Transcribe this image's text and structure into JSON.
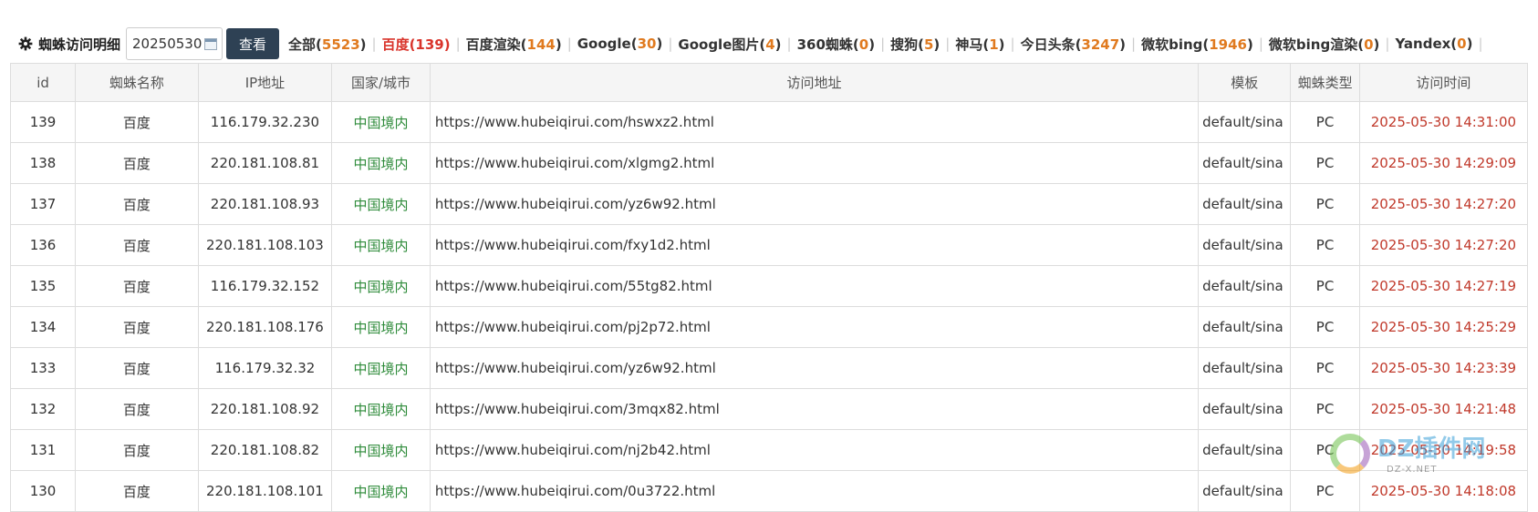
{
  "toolbar": {
    "title": "蜘蛛访问明细",
    "date_value": "20250530",
    "view_button": "查看",
    "filters": [
      {
        "label": "全部(",
        "count": "5523",
        "suffix": ")",
        "active": false
      },
      {
        "label": "百度(",
        "count": "139",
        "suffix": ")",
        "active": true
      },
      {
        "label": "百度渲染(",
        "count": "144",
        "suffix": ")",
        "active": false
      },
      {
        "label": "Google(",
        "count": "30",
        "suffix": ")",
        "active": false
      },
      {
        "label": "Google图片(",
        "count": "4",
        "suffix": ")",
        "active": false
      },
      {
        "label": "360蜘蛛(",
        "count": "0",
        "suffix": ")",
        "active": false
      },
      {
        "label": "搜狗(",
        "count": "5",
        "suffix": ")",
        "active": false
      },
      {
        "label": "神马(",
        "count": "1",
        "suffix": ")",
        "active": false
      },
      {
        "label": "今日头条(",
        "count": "3247",
        "suffix": ")",
        "active": false
      },
      {
        "label": "微软bing(",
        "count": "1946",
        "suffix": ")",
        "active": false
      },
      {
        "label": "微软bing渲染(",
        "count": "0",
        "suffix": ")",
        "active": false
      },
      {
        "label": "Yandex(",
        "count": "0",
        "suffix": ")",
        "active": false
      }
    ]
  },
  "table": {
    "headers": [
      "id",
      "蜘蛛名称",
      "IP地址",
      "国家/城市",
      "访问地址",
      "模板",
      "蜘蛛类型",
      "访问时间"
    ],
    "rows": [
      [
        "139",
        "百度",
        "116.179.32.230",
        "中国境内",
        "https://www.hubeiqirui.com/hswxz2.html",
        "default/sina",
        "PC",
        "2025-05-30 14:31:00"
      ],
      [
        "138",
        "百度",
        "220.181.108.81",
        "中国境内",
        "https://www.hubeiqirui.com/xlgmg2.html",
        "default/sina",
        "PC",
        "2025-05-30 14:29:09"
      ],
      [
        "137",
        "百度",
        "220.181.108.93",
        "中国境内",
        "https://www.hubeiqirui.com/yz6w92.html",
        "default/sina",
        "PC",
        "2025-05-30 14:27:20"
      ],
      [
        "136",
        "百度",
        "220.181.108.103",
        "中国境内",
        "https://www.hubeiqirui.com/fxy1d2.html",
        "default/sina",
        "PC",
        "2025-05-30 14:27:20"
      ],
      [
        "135",
        "百度",
        "116.179.32.152",
        "中国境内",
        "https://www.hubeiqirui.com/55tg82.html",
        "default/sina",
        "PC",
        "2025-05-30 14:27:19"
      ],
      [
        "134",
        "百度",
        "220.181.108.176",
        "中国境内",
        "https://www.hubeiqirui.com/pj2p72.html",
        "default/sina",
        "PC",
        "2025-05-30 14:25:29"
      ],
      [
        "133",
        "百度",
        "116.179.32.32",
        "中国境内",
        "https://www.hubeiqirui.com/yz6w92.html",
        "default/sina",
        "PC",
        "2025-05-30 14:23:39"
      ],
      [
        "132",
        "百度",
        "220.181.108.92",
        "中国境内",
        "https://www.hubeiqirui.com/3mqx82.html",
        "default/sina",
        "PC",
        "2025-05-30 14:21:48"
      ],
      [
        "131",
        "百度",
        "220.181.108.82",
        "中国境内",
        "https://www.hubeiqirui.com/nj2b42.html",
        "default/sina",
        "PC",
        "2025-05-30 14:19:58"
      ],
      [
        "130",
        "百度",
        "220.181.108.101",
        "中国境内",
        "https://www.hubeiqirui.com/0u3722.html",
        "default/sina",
        "PC",
        "2025-05-30 14:18:08"
      ]
    ]
  },
  "watermark": {
    "text": "DZ插件网",
    "sub": "DZ-X.NET"
  },
  "colors": {
    "accent_count": "#e07a1f",
    "active": "#d9342b",
    "geo": "#2e8b3a",
    "time": "#c0392b",
    "button": "#2e4154"
  }
}
